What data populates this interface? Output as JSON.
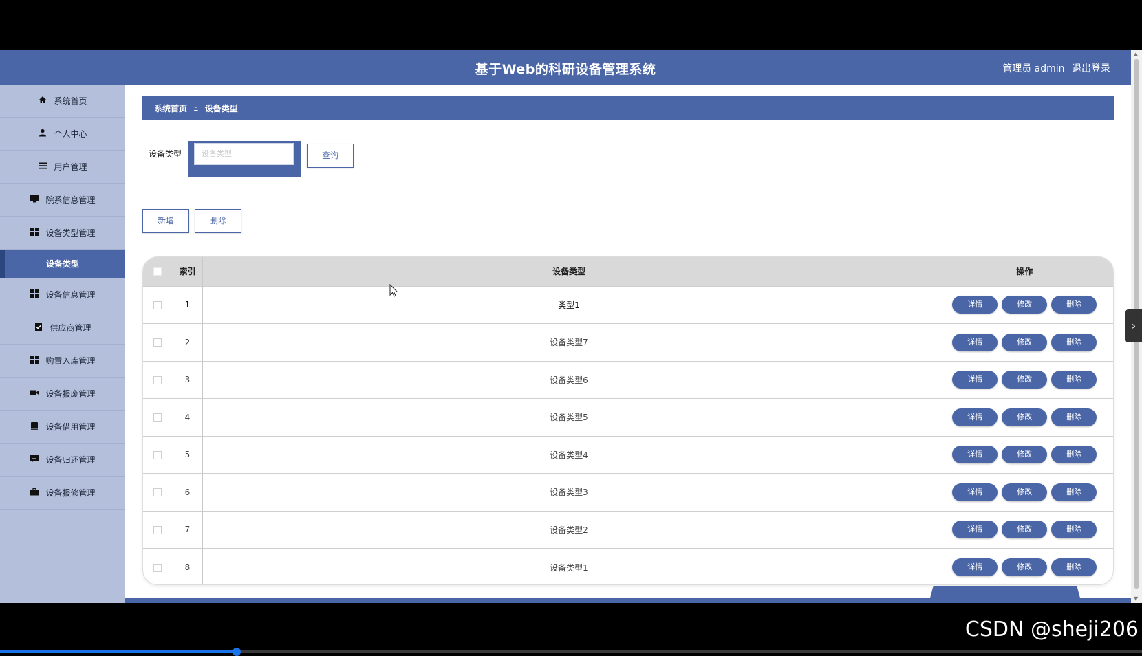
{
  "header": {
    "title": "基于Web的科研设备管理系统",
    "user_label": "管理员 admin",
    "logout_label": "退出登录"
  },
  "sidebar": {
    "items": [
      {
        "label": "系统首页",
        "icon": "home-icon"
      },
      {
        "label": "个人中心",
        "icon": "user-icon"
      },
      {
        "label": "用户管理",
        "icon": "list-icon"
      },
      {
        "label": "院系信息管理",
        "icon": "monitor-icon"
      },
      {
        "label": "设备类型管理",
        "icon": "grid-icon"
      },
      {
        "label": "设备类型",
        "icon": "",
        "active": true
      },
      {
        "label": "设备信息管理",
        "icon": "grid-icon"
      },
      {
        "label": "供应商管理",
        "icon": "clipboard-check-icon"
      },
      {
        "label": "购置入库管理",
        "icon": "grid-icon"
      },
      {
        "label": "设备报废管理",
        "icon": "video-icon"
      },
      {
        "label": "设备借用管理",
        "icon": "box-icon"
      },
      {
        "label": "设备归还管理",
        "icon": "comment-icon"
      },
      {
        "label": "设备报修管理",
        "icon": "briefcase-icon"
      }
    ]
  },
  "breadcrumb": {
    "home": "系统首页",
    "separator": "Ξ",
    "current": "设备类型"
  },
  "search": {
    "label": "设备类型",
    "placeholder": "设备类型",
    "value": "",
    "query_label": "查询"
  },
  "actions": {
    "add_label": "新增",
    "delete_label": "删除"
  },
  "table": {
    "headers": {
      "index": "索引",
      "type": "设备类型",
      "ops": "操作"
    },
    "rows": [
      {
        "index": "1",
        "type": "类型1"
      },
      {
        "index": "2",
        "type": "设备类型7"
      },
      {
        "index": "3",
        "type": "设备类型6"
      },
      {
        "index": "4",
        "type": "设备类型5"
      },
      {
        "index": "5",
        "type": "设备类型4"
      },
      {
        "index": "6",
        "type": "设备类型3"
      },
      {
        "index": "7",
        "type": "设备类型2"
      },
      {
        "index": "8",
        "type": "设备类型1"
      }
    ],
    "row_actions": {
      "detail": "详情",
      "edit": "修改",
      "delete": "删除"
    }
  },
  "watermark": "CSDN @sheji206",
  "colors": {
    "primary": "#4a66a6",
    "sidebar": "#b3bfdb",
    "table_header": "#d9d9d9"
  },
  "video_progress": 0.207
}
